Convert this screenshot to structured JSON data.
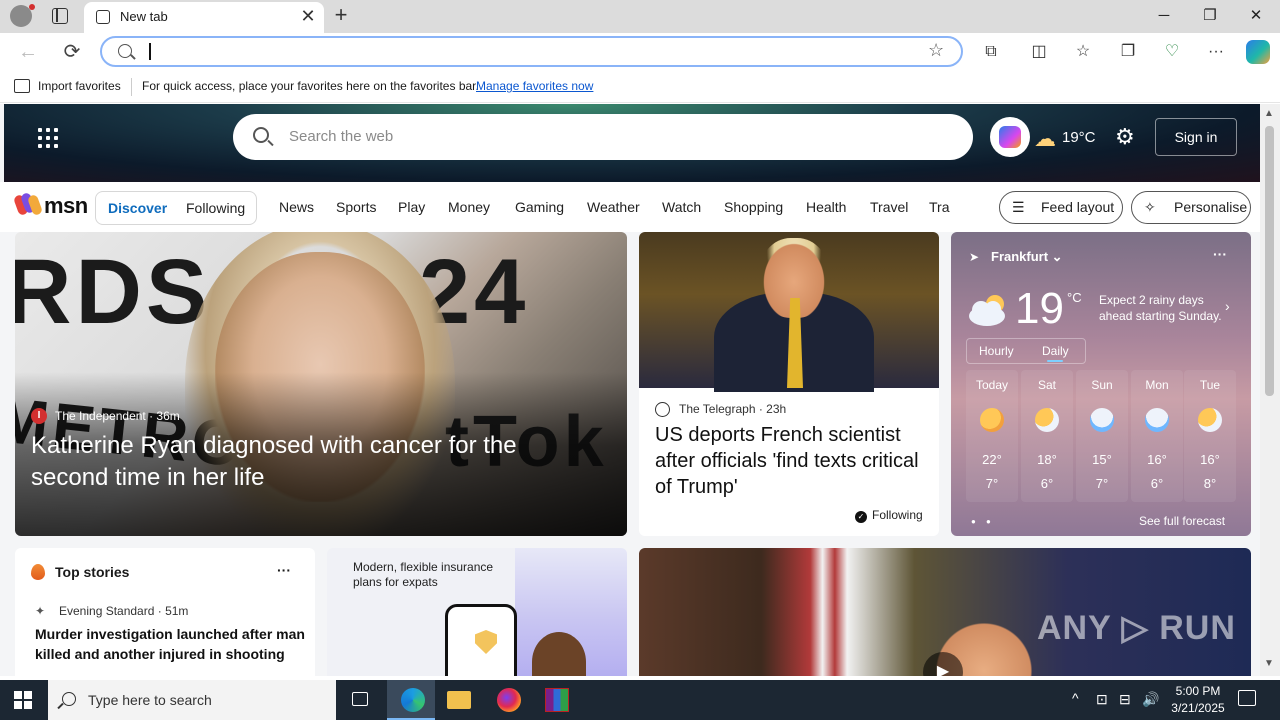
{
  "browser": {
    "tab": {
      "title": "New tab",
      "close": "✕"
    },
    "new_tab": "+",
    "window": {
      "minimize": "─",
      "maximize": "❐",
      "close": "✕"
    },
    "nav": {
      "back": "←",
      "refresh": "⟳"
    },
    "address": {
      "value": "",
      "star": "☆"
    },
    "toolbar_icons": [
      "extensions-icon",
      "split-screen-icon",
      "favorites-icon",
      "collections-icon",
      "browser-essentials-icon",
      "more-icon"
    ],
    "toolbar_glyphs": {
      "extensions": "⧉",
      "split": "◫",
      "favorites": "☆",
      "collections": "❐",
      "essentials": "♡",
      "more": "···"
    }
  },
  "favorites_bar": {
    "import_label": "Import favorites",
    "message": "For quick access, place your favorites here on the favorites bar.",
    "link": "Manage favorites now"
  },
  "msn": {
    "search_placeholder": "Search the web",
    "weather_temp": "19°C",
    "sign_in": "Sign in",
    "logo": "msn",
    "feed_tabs": {
      "discover": "Discover",
      "following": "Following"
    },
    "nav_links": [
      "News",
      "Sports",
      "Play",
      "Money",
      "Gaming",
      "Weather",
      "Watch",
      "Shopping",
      "Health",
      "Travel",
      "Tra"
    ],
    "feed_layout": "Feed layout",
    "personalise": "Personalise"
  },
  "hero": {
    "background_text": "RDS 24\nMETRO  tTok",
    "source": "The Independent · 36m",
    "source_badge": "I",
    "title": "Katherine Ryan diagnosed with cancer for the second time in her life"
  },
  "telegraph": {
    "source": "The Telegraph · 23h",
    "title": "US deports French scientist after officials 'find texts critical of Trump'",
    "following": "Following"
  },
  "weather": {
    "location": "Frankfurt ⌄",
    "temp": "19",
    "unit": "°C",
    "alert": "Expect 2 rainy days ahead starting Sunday.",
    "tabs": {
      "hourly": "Hourly",
      "daily": "Daily"
    },
    "days": [
      {
        "name": "Today",
        "hi": "22°",
        "lo": "7°",
        "icon": "partly-sunny-icon"
      },
      {
        "name": "Sat",
        "hi": "18°",
        "lo": "6°",
        "icon": "partly-sunny-icon"
      },
      {
        "name": "Sun",
        "hi": "15°",
        "lo": "7°",
        "icon": "rain-icon"
      },
      {
        "name": "Mon",
        "hi": "16°",
        "lo": "6°",
        "icon": "rain-icon"
      },
      {
        "name": "Tue",
        "hi": "16°",
        "lo": "8°",
        "icon": "partly-sunny-icon"
      }
    ],
    "see_forecast": "See full forecast",
    "more": "···",
    "dots": "● ●"
  },
  "top_stories": {
    "title": "Top stories",
    "more": "···",
    "source": "Evening Standard · 51m",
    "headline": "Murder investigation launched after man killed and another injured in shooting"
  },
  "ad": {
    "text": "Modern, flexible insurance plans for expats"
  },
  "video_card": {
    "watermark": "ANY ▷ RUN",
    "play": "▶"
  },
  "taskbar": {
    "search_placeholder": "Type here to search",
    "time": "5:00 PM",
    "date": "3/21/2025",
    "tray_up": "^",
    "tray_glyphs": [
      "⊡",
      "⊟",
      "🔊"
    ]
  }
}
